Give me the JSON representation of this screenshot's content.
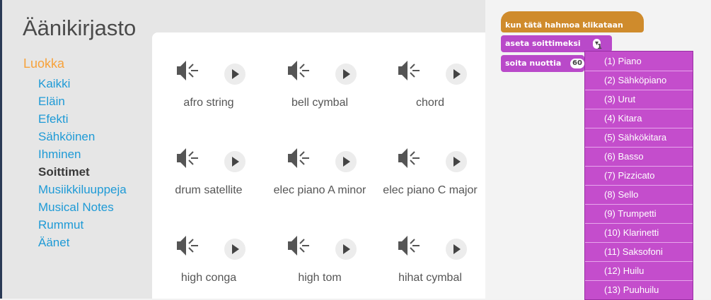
{
  "library": {
    "title": "Äänikirjasto",
    "category_heading": "Luokka",
    "categories": [
      "Kaikki",
      "Eläin",
      "Efekti",
      "Sähköinen",
      "Ihminen",
      "Soittimet",
      "Musiikkiluuppeja",
      "Musical Notes",
      "Rummut",
      "Äänet"
    ],
    "selected_category": "Soittimet",
    "sounds": [
      "afro string",
      "bell cymbal",
      "chord",
      "drum satellite",
      "elec piano A minor",
      "elec piano C major",
      "high conga",
      "high tom",
      "hihat cymbal"
    ]
  },
  "scripts": {
    "hat_block": "kun tätä hahmoa klikataan",
    "set_instrument_block": "aseta soittimeksi",
    "set_instrument_value": "1",
    "play_note_block": "soita nuottia",
    "play_note_value": "60",
    "instrument_options": [
      "(1) Piano",
      "(2) Sähköpiano",
      "(3) Urut",
      "(4) Kitara",
      "(5) Sähkökitara",
      "(6) Basso",
      "(7) Pizzicato",
      "(8) Sello",
      "(9) Trumpetti",
      "(10) Klarinetti",
      "(11) Saksofoni",
      "(12) Huilu",
      "(13) Puuhuilu"
    ]
  },
  "colors": {
    "category_accent": "#f7a23a",
    "link": "#1e9ad6",
    "events_block": "#cf8b2c",
    "sound_block": "#b949c9"
  }
}
